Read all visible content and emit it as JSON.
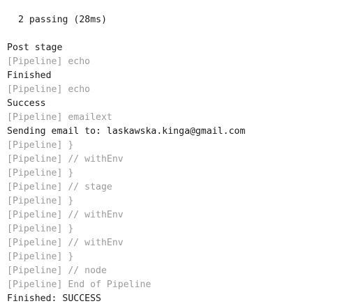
{
  "console": {
    "lines": [
      {
        "text": "2 passing (28ms)",
        "kind": "output",
        "indent": true
      },
      {
        "text": "",
        "kind": "output",
        "indent": false
      },
      {
        "text": "Post stage",
        "kind": "output",
        "indent": false
      },
      {
        "text": "[Pipeline] echo",
        "kind": "pipeline",
        "indent": false
      },
      {
        "text": "Finished",
        "kind": "output",
        "indent": false
      },
      {
        "text": "[Pipeline] echo",
        "kind": "pipeline",
        "indent": false
      },
      {
        "text": "Success",
        "kind": "output",
        "indent": false
      },
      {
        "text": "[Pipeline] emailext",
        "kind": "pipeline",
        "indent": false
      },
      {
        "text": "Sending email to: laskawska.kinga@gmail.com",
        "kind": "output",
        "indent": false
      },
      {
        "text": "[Pipeline] }",
        "kind": "pipeline",
        "indent": false
      },
      {
        "text": "[Pipeline] // withEnv",
        "kind": "pipeline",
        "indent": false
      },
      {
        "text": "[Pipeline] }",
        "kind": "pipeline",
        "indent": false
      },
      {
        "text": "[Pipeline] // stage",
        "kind": "pipeline",
        "indent": false
      },
      {
        "text": "[Pipeline] }",
        "kind": "pipeline",
        "indent": false
      },
      {
        "text": "[Pipeline] // withEnv",
        "kind": "pipeline",
        "indent": false
      },
      {
        "text": "[Pipeline] }",
        "kind": "pipeline",
        "indent": false
      },
      {
        "text": "[Pipeline] // withEnv",
        "kind": "pipeline",
        "indent": false
      },
      {
        "text": "[Pipeline] }",
        "kind": "pipeline",
        "indent": false
      },
      {
        "text": "[Pipeline] // node",
        "kind": "pipeline",
        "indent": false
      },
      {
        "text": "[Pipeline] End of Pipeline",
        "kind": "pipeline",
        "indent": false
      },
      {
        "text": "Finished: SUCCESS",
        "kind": "output",
        "indent": false
      }
    ]
  },
  "colors": {
    "output_text": "#1a1a1a",
    "pipeline_text": "#9a9a9a",
    "background": "#ffffff"
  }
}
